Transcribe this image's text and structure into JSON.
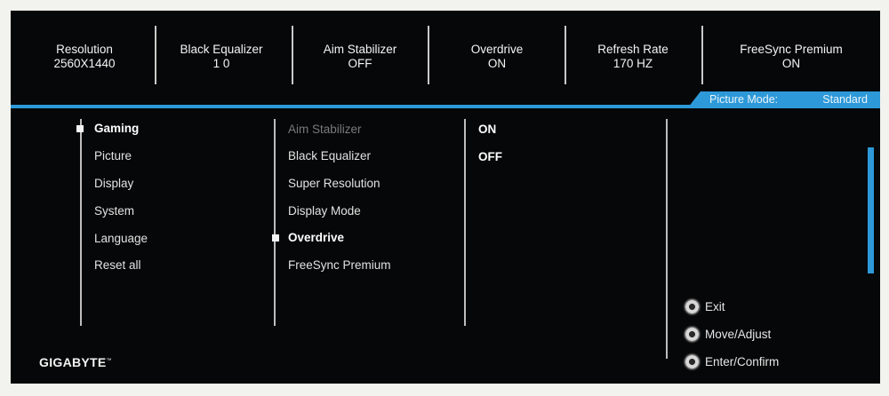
{
  "info_bar": [
    {
      "label": "Resolution",
      "value": "2560X1440"
    },
    {
      "label": "Black Equalizer",
      "value": "1 0"
    },
    {
      "label": "Aim Stabilizer",
      "value": "OFF"
    },
    {
      "label": "Overdrive",
      "value": "ON"
    },
    {
      "label": "Refresh Rate",
      "value": "170 HZ"
    },
    {
      "label": "FreeSync Premium",
      "value": "ON"
    }
  ],
  "picture_mode": {
    "label": "Picture Mode:",
    "value": "Standard"
  },
  "main_menu": [
    "Gaming",
    "Picture",
    "Display",
    "System",
    "Language",
    "Reset all"
  ],
  "main_menu_selected": "Gaming",
  "sub_menu": [
    "Aim Stabilizer",
    "Black Equalizer",
    "Super Resolution",
    "Display Mode",
    "Overdrive",
    "FreeSync Premium"
  ],
  "sub_menu_selected": "Overdrive",
  "options": [
    "ON",
    "OFF"
  ],
  "help": [
    "Exit",
    "Move/Adjust",
    "Enter/Confirm"
  ],
  "brand": {
    "name": "GIGABYTE",
    "mark": "™"
  },
  "colors": {
    "accent": "#2d99d8",
    "background": "#060708",
    "text": "#e2e2e2"
  }
}
